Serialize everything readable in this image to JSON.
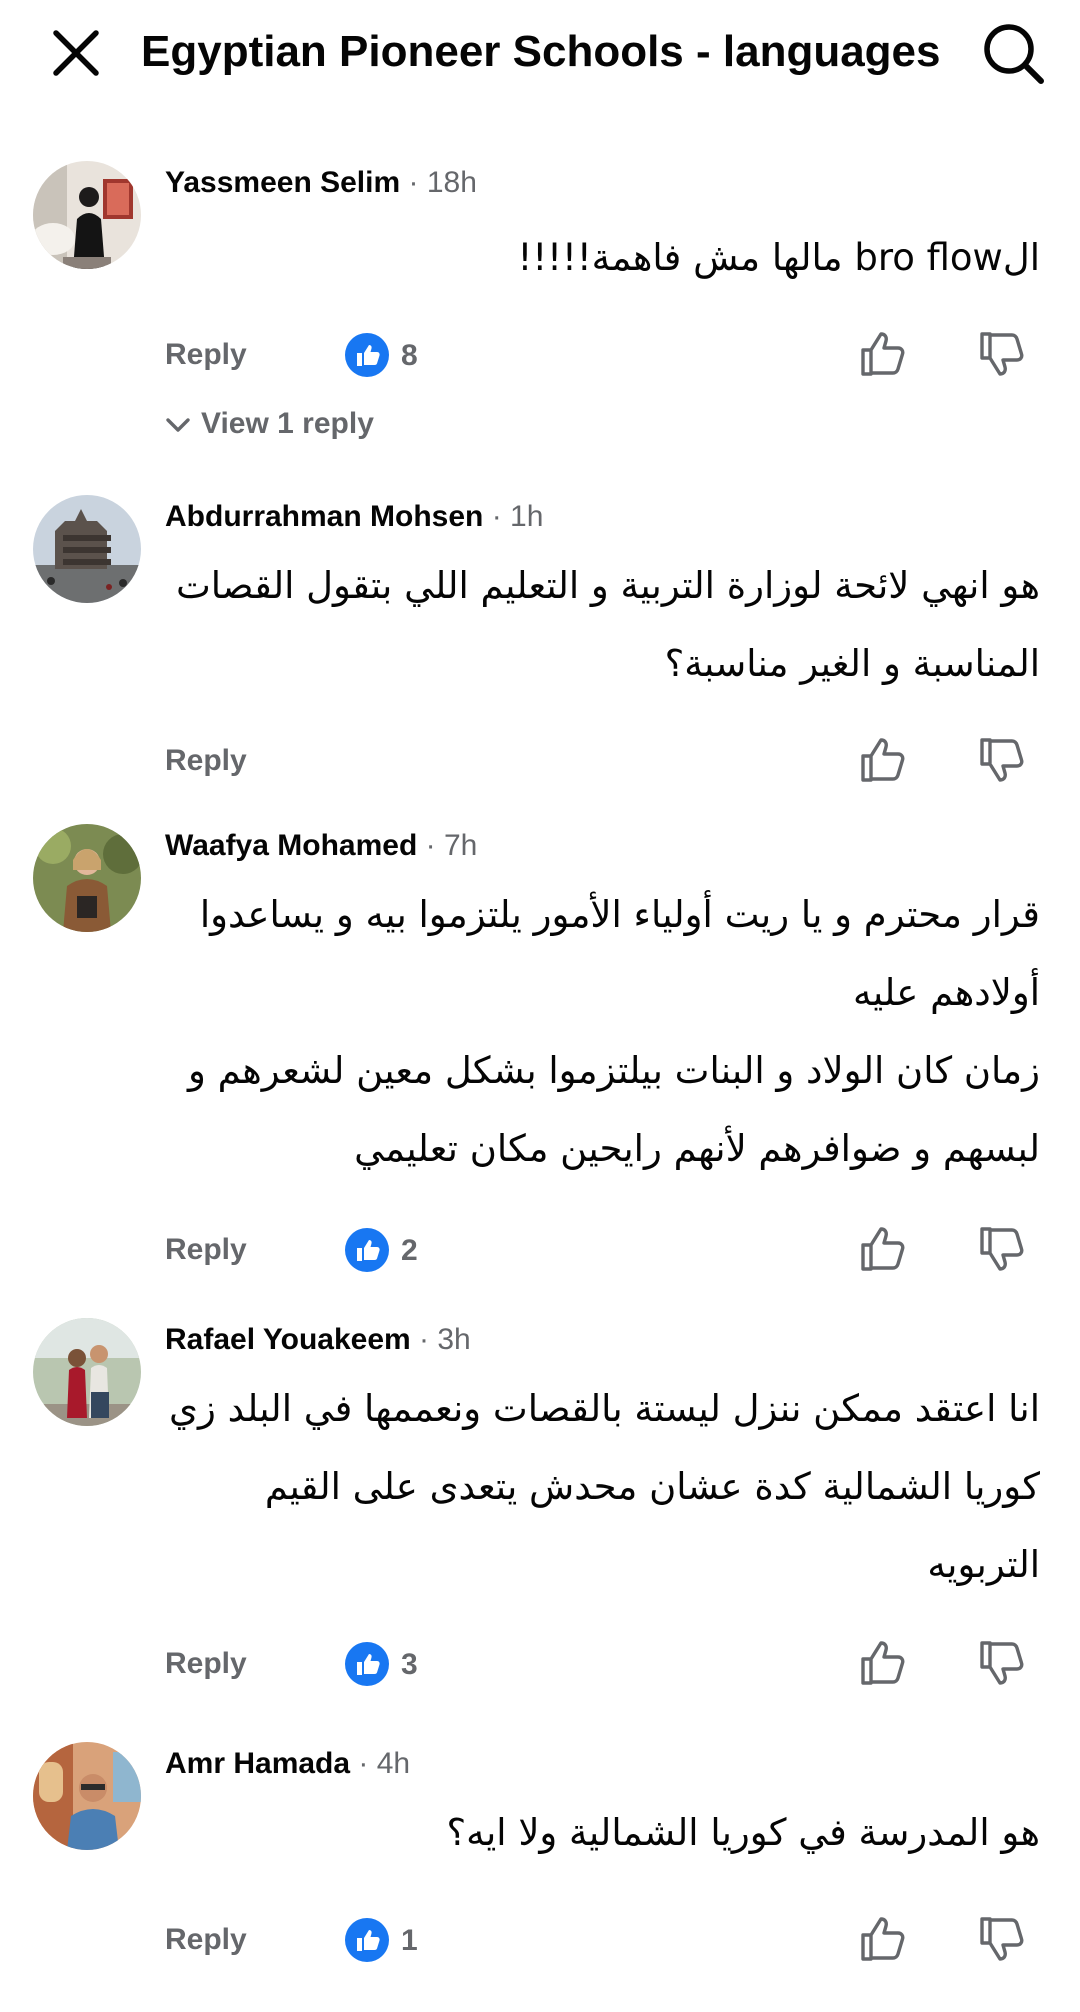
{
  "header": {
    "title": "Egyptian Pioneer Schools - languages",
    "close_icon": "close-icon",
    "search_icon": "search-icon"
  },
  "colors": {
    "text": "#050505",
    "secondary": "#65676b",
    "like_blue": "#1877f2"
  },
  "reply_label": "Reply",
  "comments": [
    {
      "author": "Yassmeen Selim",
      "time": "18h",
      "lines": [
        "الbro flow مالها مش فاهمة!!!!!"
      ],
      "reactions": "8",
      "view_replies": "View 1 reply"
    },
    {
      "author": "Abdurrahman Mohsen",
      "time": "1h",
      "lines": [
        "هو انهي لائحة لوزارة التربية و التعليم اللي بتقول القصات",
        "المناسبة و الغير مناسبة؟"
      ],
      "reactions": ""
    },
    {
      "author": "Waafya Mohamed",
      "time": "7h",
      "lines": [
        "قرار محترم و يا ريت أولياء الأمور يلتزموا بيه و يساعدوا",
        "أولادهم عليه",
        "زمان كان الولاد و البنات بيلتزموا بشكل معين لشعرهم و",
        "لبسهم و ضوافرهم لأنهم رايحين مكان تعليمي"
      ],
      "reactions": "2"
    },
    {
      "author": "Rafael Youakeem",
      "time": "3h",
      "lines": [
        "انا اعتقد ممكن ننزل ليستة بالقصات ونعممها في البلد زي",
        "كوريا الشمالية كدة عشان محدش يتعدى على القيم",
        "التربويه"
      ],
      "reactions": "3"
    },
    {
      "author": "Amr Hamada",
      "time": "4h",
      "lines": [
        "هو المدرسة في كوريا الشمالية ولا ايه؟"
      ],
      "reactions": "1"
    }
  ]
}
